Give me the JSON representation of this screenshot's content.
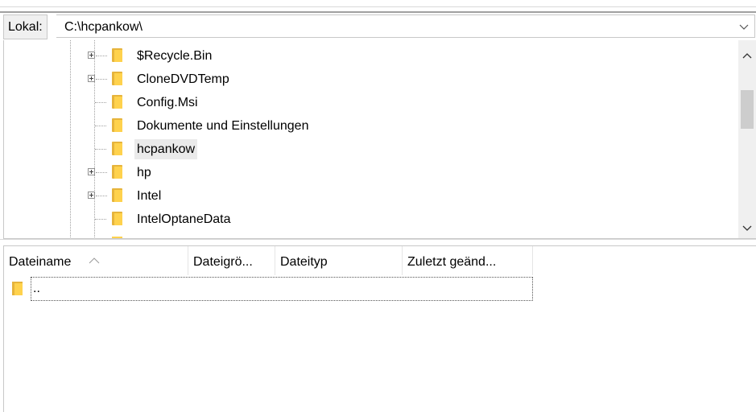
{
  "pathbar": {
    "label": "Lokal:",
    "path": "C:\\hcpankow\\",
    "dropdown_icon": "chevron-down-icon"
  },
  "tree": {
    "items": [
      {
        "label": "$Recycle.Bin",
        "expandable": true,
        "selected": false
      },
      {
        "label": "CloneDVDTemp",
        "expandable": true,
        "selected": false
      },
      {
        "label": "Config.Msi",
        "expandable": false,
        "selected": false
      },
      {
        "label": "Dokumente und Einstellungen",
        "expandable": false,
        "selected": false
      },
      {
        "label": "hcpankow",
        "expandable": false,
        "selected": true
      },
      {
        "label": "hp",
        "expandable": true,
        "selected": false
      },
      {
        "label": "Intel",
        "expandable": true,
        "selected": false
      },
      {
        "label": "IntelOptaneData",
        "expandable": false,
        "selected": false
      }
    ],
    "scrollbar": {
      "up_icon": "chevron-up-icon",
      "down_icon": "chevron-down-icon"
    }
  },
  "filelist": {
    "columns": [
      "Dateiname",
      "Dateigrö...",
      "Dateityp",
      "Zuletzt geänd..."
    ],
    "sort_icon": "sort-ascending-icon",
    "rows": [
      {
        "name": ".."
      }
    ]
  },
  "colors": {
    "folder_front": "#ffd24d",
    "folder_back": "#e6b43c",
    "selection": "#eaeaea",
    "border": "#c8c8c8"
  }
}
